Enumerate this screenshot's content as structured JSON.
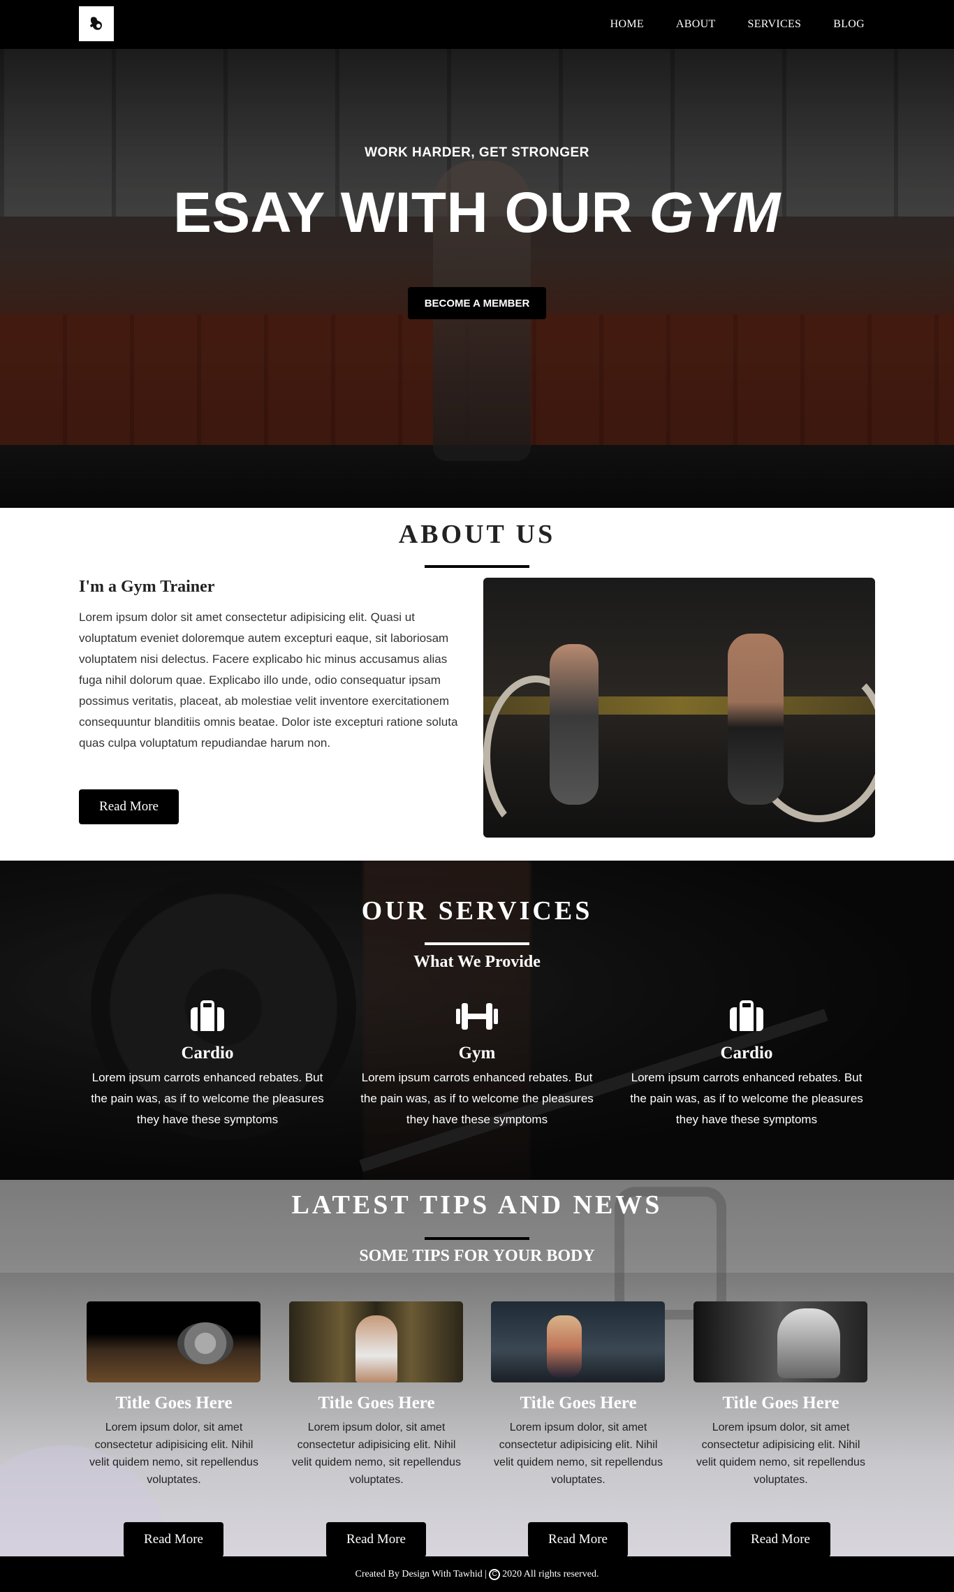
{
  "nav": {
    "items": [
      "HOME",
      "ABOUT",
      "SERVICES",
      "BLOG"
    ]
  },
  "hero": {
    "subtitle": "WORK HARDER, GET STRONGER",
    "title_main": "ESAY WITH OUR",
    "title_em": "GYM",
    "button": "BECOME A MEMBER"
  },
  "about": {
    "title": "ABOUT US",
    "heading": "I'm a Gym Trainer",
    "body": "Lorem ipsum dolor sit amet consectetur adipisicing elit. Quasi ut voluptatum eveniet doloremque autem excepturi eaque, sit laboriosam voluptatem nisi delectus. Facere explicabo hic minus accusamus alias fuga nihil dolorum quae. Explicabo illo unde, odio consequatur ipsam possimus veritatis, placeat, ab molestiae velit inventore exercitationem consequuntur blanditiis omnis beatae. Dolor iste excepturi ratione soluta quas culpa voluptatum repudiandae harum non.",
    "button": "Read More"
  },
  "services": {
    "title": "OUR SERVICES",
    "subtitle": "What We Provide",
    "items": [
      {
        "icon": "suitcase-icon",
        "title": "Cardio",
        "text": "Lorem ipsum carrots enhanced rebates. But the pain was, as if to welcome the pleasures they have these symptoms"
      },
      {
        "icon": "dumbbell-icon",
        "title": "Gym",
        "text": "Lorem ipsum carrots enhanced rebates. But the pain was, as if to welcome the pleasures they have these symptoms"
      },
      {
        "icon": "suitcase-icon",
        "title": "Cardio",
        "text": "Lorem ipsum carrots enhanced rebates. But the pain was, as if to welcome the pleasures they have these symptoms"
      }
    ]
  },
  "news": {
    "title": "LATEST TIPS AND NEWS",
    "subtitle": "SOME TIPS FOR YOUR BODY",
    "cards": [
      {
        "title": "Title Goes Here",
        "text": "Lorem ipsum dolor, sit amet consectetur adipisicing elit. Nihil velit quidem nemo, sit repellendus voluptates.",
        "button": "Read More"
      },
      {
        "title": "Title Goes Here",
        "text": "Lorem ipsum dolor, sit amet consectetur adipisicing elit. Nihil velit quidem nemo, sit repellendus voluptates.",
        "button": "Read More"
      },
      {
        "title": "Title Goes Here",
        "text": "Lorem ipsum dolor, sit amet consectetur adipisicing elit. Nihil velit quidem nemo, sit repellendus voluptates.",
        "button": "Read More"
      },
      {
        "title": "Title Goes Here",
        "text": "Lorem ipsum dolor, sit amet consectetur adipisicing elit. Nihil velit quidem nemo, sit repellendus voluptates.",
        "button": "Read More"
      }
    ]
  },
  "footer": {
    "prefix": "Created By Design With Tawhid |",
    "suffix": "2020 All rights reserved."
  },
  "colors": {
    "primary": "#000000",
    "text_light": "#ffffff",
    "text_dark": "#222222"
  }
}
